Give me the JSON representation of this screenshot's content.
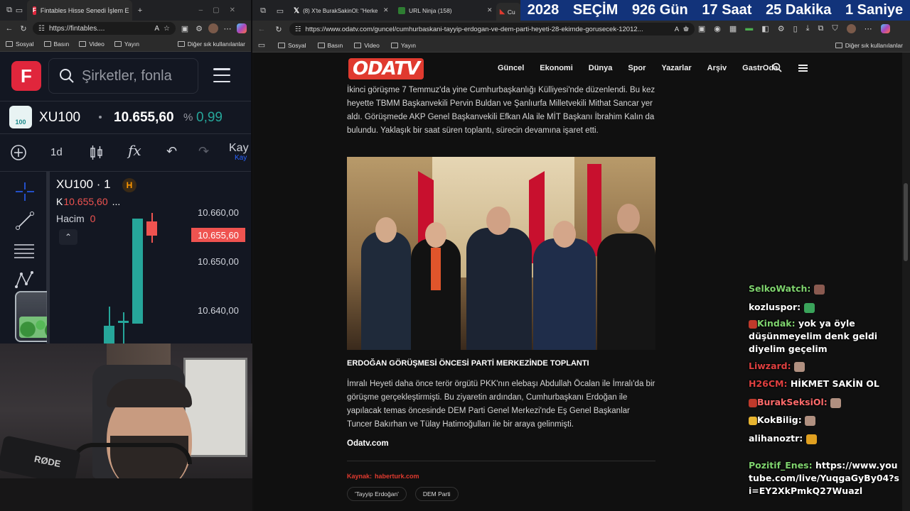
{
  "left_browser": {
    "tab_title": "Fintables Hisse Senedi İşlem E",
    "url": "https://fintables....",
    "bookmarks": [
      "Sosyal",
      "Basın",
      "Video",
      "Yayın"
    ],
    "other_bookmarks": "Diğer sık kullanılanlar"
  },
  "fintables": {
    "logo": "F",
    "search_placeholder": "Şirketler, fonla",
    "symbol": "XU100",
    "badge_text": "100",
    "price": "10.655,60",
    "change_prefix": "%",
    "change": "0,99",
    "toolbar": {
      "interval": "1d",
      "fx_label": "fx",
      "save_label": "Kay",
      "save_sub": "Kay"
    },
    "chart": {
      "title": "XU100 · 1",
      "h_badge": "H",
      "k_label": "K",
      "k_value": "10.655,60",
      "k_ellipsis": "...",
      "volume_label": "Hacim",
      "volume_value": "0",
      "price_ticks": [
        "10.660,00",
        "10.650,00",
        "10.640,00"
      ],
      "current_price_tag": "10.655,60"
    },
    "colors": {
      "up": "#26a69a",
      "down": "#ef5350",
      "accent": "#e0263c"
    }
  },
  "right_browser": {
    "tabs": [
      {
        "title": "(8) X'te BurakSakinOl: \"Herke",
        "icon": "x-icon"
      },
      {
        "title": "URL Ninja (158)",
        "icon": "url-ninja-icon"
      },
      {
        "title": "Cu",
        "icon": "odatv-icon"
      }
    ],
    "url": "https://www.odatv.com/guncel/cumhurbaskani-tayyip-erdogan-ve-dem-parti-heyeti-28-ekimde-gorusecek-12012...",
    "bookmarks": [
      "Sosyal",
      "Basın",
      "Video",
      "Yayın"
    ],
    "other_bookmarks": "Diğer sık kullanılanlar"
  },
  "election_banner": {
    "items": [
      "2028",
      "SEÇİM",
      "926 Gün",
      "17 Saat",
      "25 Dakika",
      "1 Saniye"
    ]
  },
  "odatv": {
    "logo": "ODATV",
    "nav": [
      "Güncel",
      "Ekonomi",
      "Dünya",
      "Spor",
      "Yazarlar",
      "Arşiv",
      "GastrOda"
    ],
    "paragraph1": "İkinci görüşme 7 Temmuz'da yine Cumhurbaşkanlığı Külliyesi'nde düzenlendi. Bu kez heyette TBMM Başkanvekili Pervin Buldan ve Şanlıurfa Milletvekili Mithat Sancar yer aldı. Görüşmede AKP Genel Başkanvekili Efkan Ala ile MİT Başkanı İbrahim Kalın da bulundu. Yaklaşık bir saat süren toplantı, sürecin devamına işaret etti.",
    "heading": "ERDOĞAN GÖRÜŞMESİ ÖNCESİ PARTİ MERKEZİNDE TOPLANTI",
    "paragraph2": "İmralı Heyeti daha önce terör örgütü PKK'nın elebaşı Abdullah Öcalan ile İmralı'da bir görüşme gerçekleştirmişti. Bu ziyaretin ardından, Cumhurbaşkanı Erdoğan ile yapılacak temas öncesinde DEM Parti Genel Merkezi'nde Eş Genel Başkanlar Tuncer Bakırhan ve Tülay Hatimoğulları ile bir araya gelinmişti.",
    "source_site": "Odatv.com",
    "source_label": "Kaynak:",
    "source_value": "haberturk.com",
    "tags": [
      "Tayyip Erdoğan",
      "DEM Parti"
    ]
  },
  "chat": [
    {
      "user": "SelkoWatch:",
      "text": "",
      "color": "#7fd36e"
    },
    {
      "user": "kozluspor:",
      "text": "",
      "color": "#ffffff"
    },
    {
      "user": "Kindak:",
      "text": "yok ya öyle düşünmeyelim denk geldi diyelim geçelim",
      "color": "#7fd36e"
    },
    {
      "user": "Liwzard:",
      "text": "",
      "color": "#e04040"
    },
    {
      "user": "H26CM:",
      "text": "HİKMET SAKİN OL",
      "color": "#e04040"
    },
    {
      "user": "BurakSeksiOl:",
      "text": "",
      "color": "#ff6b6b"
    },
    {
      "user": "KokBilig:",
      "text": "",
      "color": "#ffffff"
    },
    {
      "user": "alihanoztr:",
      "text": "",
      "color": "#ffffff"
    },
    {
      "user": "Pozitif_Enes:",
      "text": "https://www.youtube.com/live/YuqgaGyBy04?si=EY2XkPmkQ27Wuazl",
      "color": "#7fd36e"
    }
  ],
  "webcam": {
    "mic_brand": "RØDE"
  }
}
